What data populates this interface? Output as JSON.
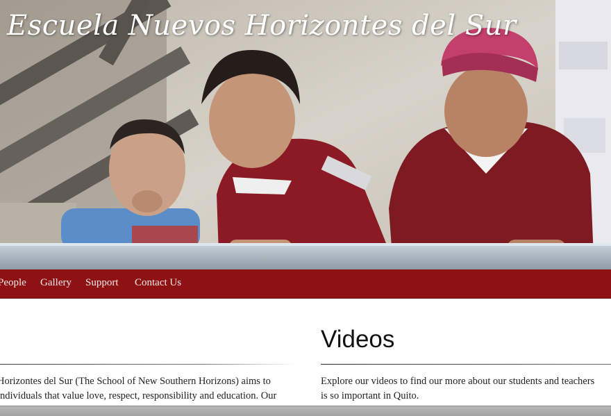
{
  "site": {
    "title": "Escuela Nuevos Horizontes del Sur"
  },
  "hero": {
    "alt": "Three schoolchildren in red school sweaters leaning on a concrete wall"
  },
  "nav": {
    "items": [
      {
        "label": "People"
      },
      {
        "label": "Gallery"
      },
      {
        "label": "Support"
      },
      {
        "label": "Contact Us"
      }
    ]
  },
  "about": {
    "line1": "Horizontes del Sur (The School of New Southern Horizons) aims to",
    "line2": "individuals that value love, respect, responsibility and education. Our"
  },
  "videos": {
    "title": "Videos",
    "line1": "Explore our videos to find our more about our students and teachers",
    "line2": "is so important in Quito."
  },
  "colors": {
    "nav_bg": "#8e1114",
    "nav_text": "#f4e9e9",
    "sweater": "#8b1a24"
  }
}
